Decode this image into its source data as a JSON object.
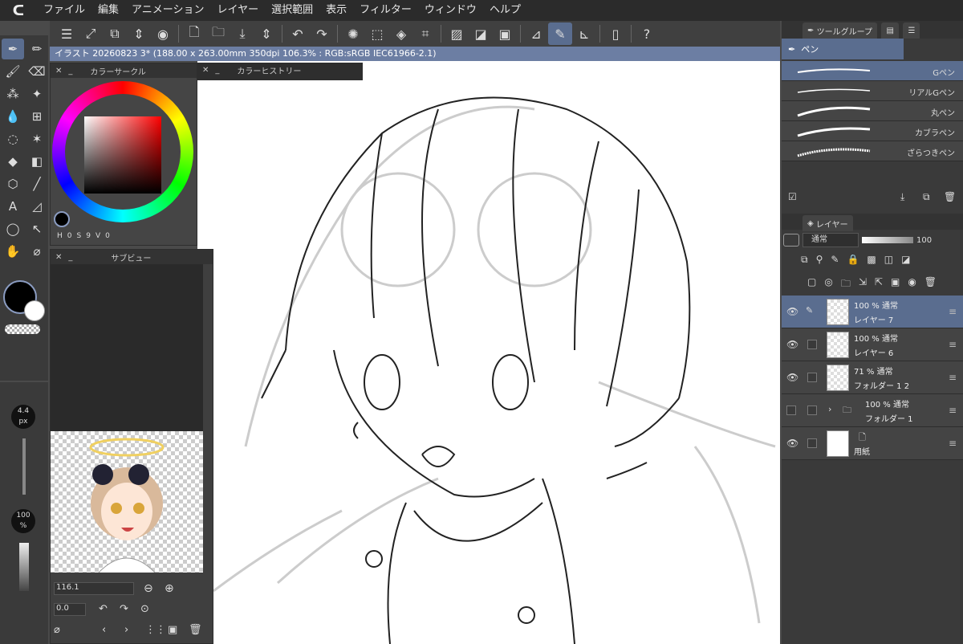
{
  "menu": {
    "logo": "ᑕ",
    "items": [
      "ファイル",
      "編集",
      "アニメーション",
      "レイヤー",
      "選択範囲",
      "表示",
      "フィルター",
      "ウィンドウ",
      "ヘルプ"
    ]
  },
  "document": {
    "title": "イラスト 20260823 3* (188.00 x 263.00mm 350dpi 106.3% : RGB:sRGB IEC61966-2.1)"
  },
  "panels": {
    "color_circle": "カラーサークル",
    "color_history": "カラーヒストリー",
    "subview": "サブビュー",
    "tool_group": "ツールグループ",
    "layer": "レイヤー"
  },
  "color": {
    "h": "0",
    "s": "9",
    "v": "0",
    "hue_label": "H",
    "sat_label": "S",
    "val_label": "V"
  },
  "tool": {
    "current": "ペン",
    "brush_size": "4.4",
    "brush_unit": "px",
    "opacity": "100",
    "opacity_unit": "%"
  },
  "brushes": [
    {
      "name": "Gペン"
    },
    {
      "name": "リアルGペン"
    },
    {
      "name": "丸ペン"
    },
    {
      "name": "カブラペン"
    },
    {
      "name": "ざらつきペン"
    }
  ],
  "layer_blend": {
    "mode": "通常",
    "opacity": "100"
  },
  "layers": [
    {
      "mode": "100 % 通常",
      "name": "レイヤー 7"
    },
    {
      "mode": "100 % 通常",
      "name": "レイヤー 6"
    },
    {
      "mode": "71 % 通常",
      "name": "フォルダー 1 2"
    },
    {
      "mode": "100 % 通常",
      "name": "フォルダー 1"
    },
    {
      "mode": "",
      "name": "用紙"
    }
  ],
  "subview_zoom": "116.1",
  "subview_rotate": "0.0"
}
